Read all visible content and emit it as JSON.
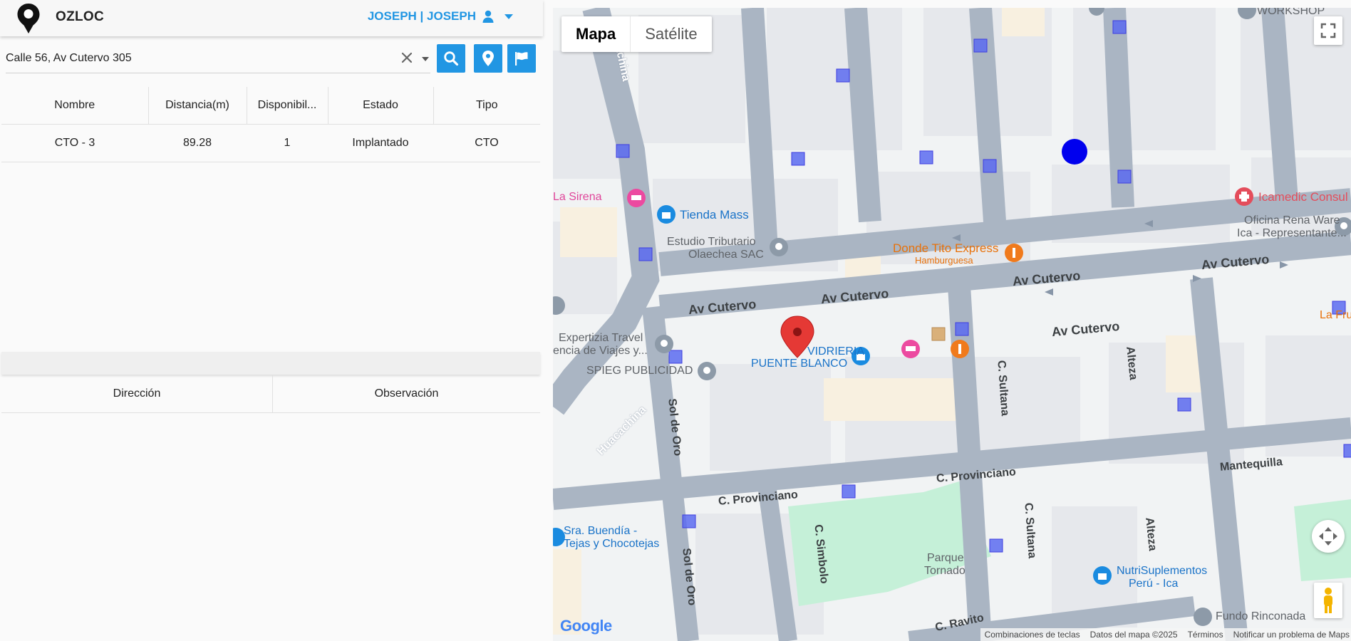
{
  "app": {
    "name": "OZLOC",
    "user": "JOSEPH | JOSEPH"
  },
  "search": {
    "value": "Calle 56, Av Cutervo 305",
    "placeholder": ""
  },
  "buttons": {
    "search": "search-icon",
    "location": "map-marker-icon",
    "flag": "flag-icon"
  },
  "table": {
    "columns": [
      "Nombre",
      "Distancia(m)",
      "Disponibil...",
      "Estado",
      "Tipo"
    ],
    "rows": [
      [
        "CTO - 3",
        "89.28",
        "1",
        "Implantado",
        "CTO"
      ]
    ]
  },
  "details_table": {
    "columns": [
      "Dirección",
      "Observación"
    ]
  },
  "map": {
    "type_buttons": [
      "Mapa",
      "Satélite"
    ],
    "selected_type": "Mapa",
    "attribution": [
      "Combinaciones de teclas",
      "Datos del mapa ©2025",
      "Términos",
      "Notificar un problema de Maps"
    ],
    "google_logo": "Google",
    "streets": [
      "Huacachina",
      "Av Cutervo",
      "Av Cutervo",
      "Av Cutervo",
      "Av Cutervo",
      "Av Cutervo",
      "C. Sultana",
      "C. Sultana",
      "Alteza",
      "Alteza",
      "Sol de Oro",
      "Sol de Oro",
      "Huacachina",
      "C. Provinciano",
      "C. Provinciano",
      "Mantequilla",
      "C. Simbolo",
      "C. Ravito"
    ],
    "places": [
      "WORKSHOP",
      "La Sirena",
      "Tienda Mass",
      "Estudio Tributario",
      "Olaechea SAC",
      "Donde Tito Express",
      "Hamburguesa",
      "Icamedic Consul",
      "Oficina Rena Ware",
      "Ica - Representante...",
      "Expertizia Travel",
      "encia de Viajes y...",
      "SPIEG PUBLICIDAD",
      "VIDRIERIA",
      "PUENTE BLANCO",
      "La Fru",
      "Sra. Buendía -",
      "Tejas y Chocotejas",
      "Parque",
      "Tornado",
      "NutriSuplementos",
      "Perú - Ica",
      "Fundo Rinconada"
    ],
    "colors": {
      "road": "#aab5c3",
      "block": "#e8eaed",
      "park": "#c5f0d8",
      "marker": "#e53935",
      "cto_square": "#5c6bf0",
      "user_dot": "#0000ee"
    }
  }
}
